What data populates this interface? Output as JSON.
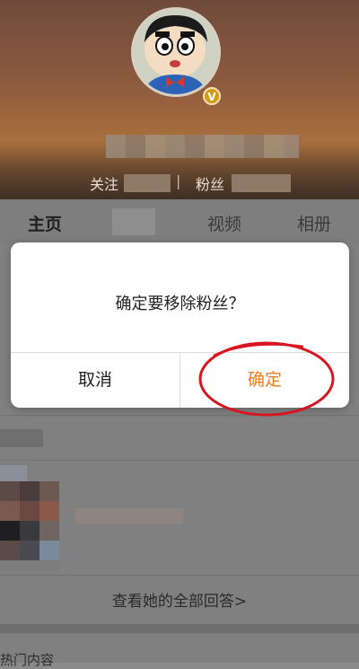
{
  "profile": {
    "verified_badge": "V",
    "follow_label": "关注",
    "separator": "|",
    "fans_label": "粉丝",
    "avatar_icon": "crayon-shin-chan-avatar"
  },
  "tabs": {
    "home": "主页",
    "video": "视频",
    "album": "相册"
  },
  "content": {
    "view_all_answers": "查看她的全部回答>",
    "bottom_partial": "热门内容"
  },
  "dialog": {
    "message": "确定要移除粉丝？",
    "cancel": "取消",
    "confirm": "确定",
    "confirm_color": "#f07c1a",
    "annotation_color": "#d8141e"
  }
}
